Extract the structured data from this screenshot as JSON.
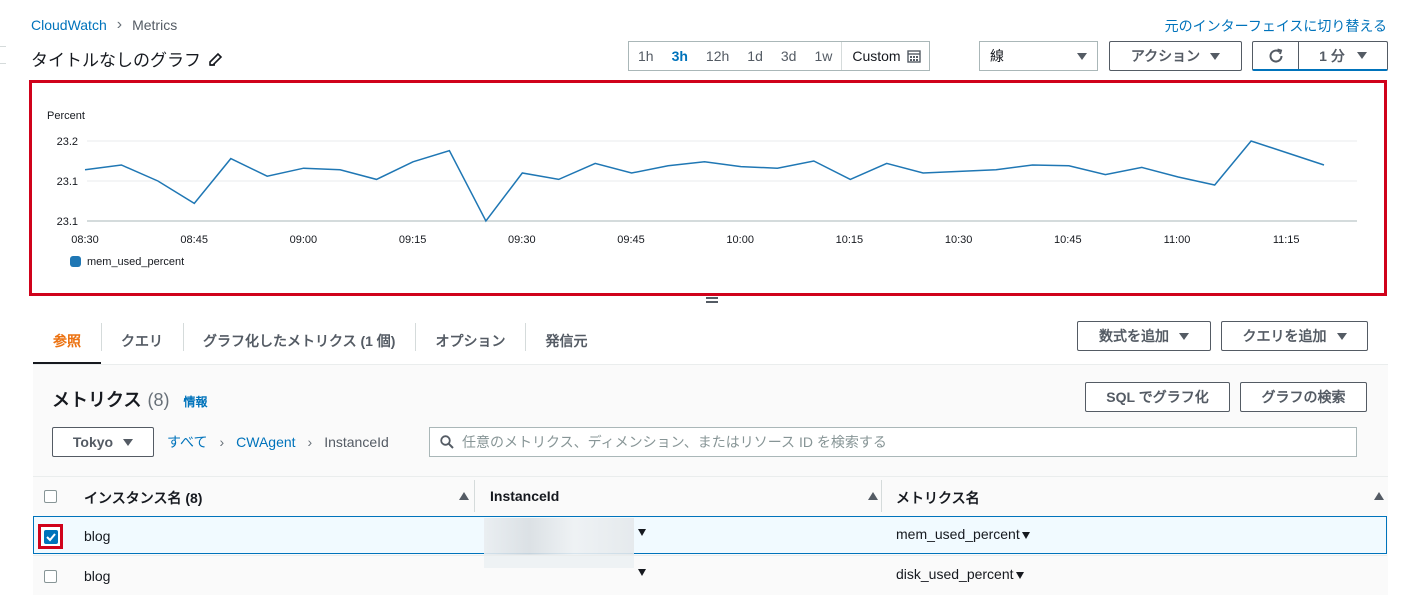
{
  "breadcrumb": {
    "root": "CloudWatch",
    "current": "Metrics"
  },
  "switch_link": "元のインターフェイスに切り替える",
  "graph_title": "タイトルなしのグラフ",
  "timerange": {
    "options": [
      "1h",
      "3h",
      "12h",
      "1d",
      "3d",
      "1w"
    ],
    "active": "3h",
    "custom": "Custom"
  },
  "chart_type_select": "線",
  "actions_label": "アクション",
  "period_label": "1 分",
  "chart_data": {
    "type": "line",
    "ylabel": "Percent",
    "yticks": [
      "23.2",
      "23.1",
      "23.1"
    ],
    "xticks": [
      "08:30",
      "08:45",
      "09:00",
      "09:15",
      "09:30",
      "09:45",
      "10:00",
      "10:15",
      "10:30",
      "10:45",
      "11:00",
      "11:15"
    ],
    "ylim": [
      23.1,
      23.2
    ],
    "series": [
      {
        "name": "mem_used_percent",
        "color": "#1f77b4",
        "x_minutes": [
          0,
          5,
          10,
          15,
          20,
          25,
          30,
          35,
          40,
          45,
          50,
          55,
          60,
          65,
          70,
          75,
          80,
          85,
          90,
          95,
          100,
          105,
          110,
          115,
          120,
          125,
          130,
          135,
          140,
          145,
          150,
          155,
          160,
          165,
          170
        ],
        "values": [
          23.164,
          23.17,
          23.15,
          23.122,
          23.178,
          23.156,
          23.166,
          23.164,
          23.152,
          23.174,
          23.188,
          23.1,
          23.16,
          23.152,
          23.172,
          23.16,
          23.169,
          23.174,
          23.168,
          23.166,
          23.175,
          23.152,
          23.172,
          23.16,
          23.162,
          23.164,
          23.17,
          23.169,
          23.158,
          23.167,
          23.155,
          23.145,
          23.2,
          23.185,
          23.17
        ]
      }
    ],
    "legend": "bottom-left"
  },
  "drag_handle": "=",
  "tabs": [
    "参照",
    "クエリ",
    "グラフ化したメトリクス (1 個)",
    "オプション",
    "発信元"
  ],
  "add_expression": "数式を追加",
  "add_query": "クエリを追加",
  "metrics": {
    "title": "メトリクス",
    "count": "(8)",
    "info": "情報"
  },
  "sql_button": "SQL でグラフ化",
  "search_graph_button": "グラフの検索",
  "region": "Tokyo",
  "nav": {
    "all": "すべて",
    "ns": "CWAgent",
    "dim": "InstanceId"
  },
  "search_placeholder": "任意のメトリクス、ディメンション、またはリソース ID を検索する",
  "table": {
    "headers": [
      "インスタンス名 (8)",
      "InstanceId",
      "メトリクス名"
    ],
    "rows": [
      {
        "name": "blog",
        "metric": "mem_used_percent",
        "checked": true
      },
      {
        "name": "blog",
        "metric": "disk_used_percent",
        "checked": false
      }
    ]
  }
}
